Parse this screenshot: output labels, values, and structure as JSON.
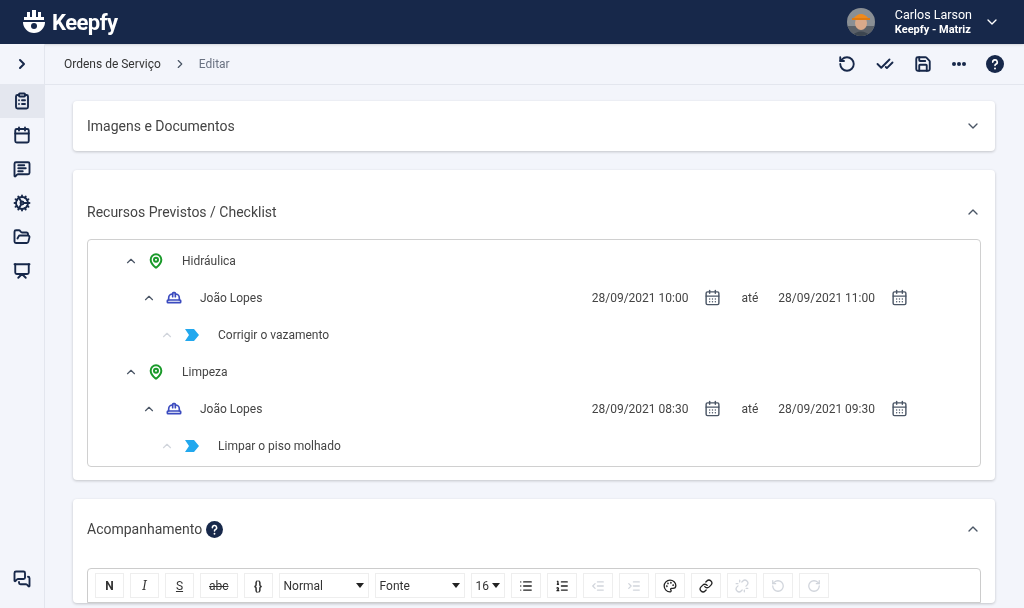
{
  "header": {
    "logo": "Keepfy",
    "user": {
      "name": "Carlos Larson",
      "company": "Keepfy - Matriz"
    }
  },
  "sidebar": {
    "items": [
      {
        "selected": true
      },
      {
        "selected": false
      },
      {
        "selected": false
      },
      {
        "selected": false
      },
      {
        "selected": false
      },
      {
        "selected": false
      }
    ]
  },
  "breadcrumb": [
    "Ordens de Serviço",
    "Editar"
  ],
  "sections": [
    {
      "title": "Imagens e Documentos",
      "expanded": false
    },
    {
      "title": "Recursos Previstos / Checklist",
      "expanded": true
    },
    {
      "title": "Acompanhamento",
      "expanded": true
    }
  ],
  "tree": [
    {
      "kind": "location",
      "label": "Hidráulica",
      "expanded": true,
      "children": [
        {
          "kind": "person",
          "label": "João Lopes",
          "expanded": true,
          "start": "28/09/2021 10:00",
          "separator": "até",
          "end": "28/09/2021 11:00",
          "children": [
            {
              "kind": "task",
              "label": "Corrigir o vazamento",
              "expanded": true
            }
          ]
        }
      ]
    },
    {
      "kind": "location",
      "label": "Limpeza",
      "expanded": true,
      "children": [
        {
          "kind": "person",
          "label": "João Lopes",
          "expanded": true,
          "start": "28/09/2021 08:30",
          "separator": "até",
          "end": "28/09/2021 09:30",
          "children": [
            {
              "kind": "task",
              "label": "Limpar o piso molhado",
              "expanded": true
            }
          ]
        }
      ]
    }
  ],
  "editor": {
    "format_buttons": [
      "N",
      "I",
      "S",
      "abc",
      "{}"
    ],
    "selects": [
      "Normal",
      "Fonte",
      "16"
    ],
    "icon_buttons": [
      {
        "disabled": false
      },
      {
        "disabled": false
      },
      {
        "disabled": true
      },
      {
        "disabled": true
      },
      {
        "disabled": false
      },
      {
        "disabled": false
      },
      {
        "disabled": true
      },
      {
        "disabled": true
      },
      {
        "disabled": true
      }
    ]
  }
}
